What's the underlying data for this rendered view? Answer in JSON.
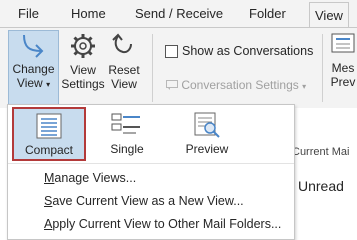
{
  "tabs": [
    {
      "label": "File"
    },
    {
      "label": "Home"
    },
    {
      "label": "Send / Receive"
    },
    {
      "label": "Folder"
    },
    {
      "label": "View"
    }
  ],
  "ribbon": {
    "change_view": {
      "line1": "Change",
      "line2": "View",
      "arrow": "▾"
    },
    "view_settings": {
      "line1": "View",
      "line2": "Settings"
    },
    "reset_view": {
      "line1": "Reset",
      "line2": "View"
    },
    "show_as_conversations": {
      "label": "Show as Conversations",
      "checked": false
    },
    "conversation_settings": {
      "label": "Conversation Settings",
      "arrow": "▾"
    },
    "messages_partial": {
      "line1": "Mes",
      "line2": "Prev"
    }
  },
  "background": {
    "column_header": "Current Mai",
    "unread_label": "Unread"
  },
  "dropdown": {
    "gallery": [
      {
        "label": "Compact",
        "icon": "compact-view-icon",
        "selected": true
      },
      {
        "label": "Single",
        "icon": "single-view-icon",
        "selected": false
      },
      {
        "label": "Preview",
        "icon": "preview-view-icon",
        "selected": false
      }
    ],
    "menu": [
      {
        "accel": "M",
        "rest": "anage Views..."
      },
      {
        "accel": "S",
        "rest": "ave Current View as a New View..."
      },
      {
        "accel": "A",
        "rest": "pply Current View to Other Mail Folders..."
      }
    ]
  },
  "colors": {
    "accent_selected": "#c8dcee",
    "selection_border": "#b33a3a"
  }
}
